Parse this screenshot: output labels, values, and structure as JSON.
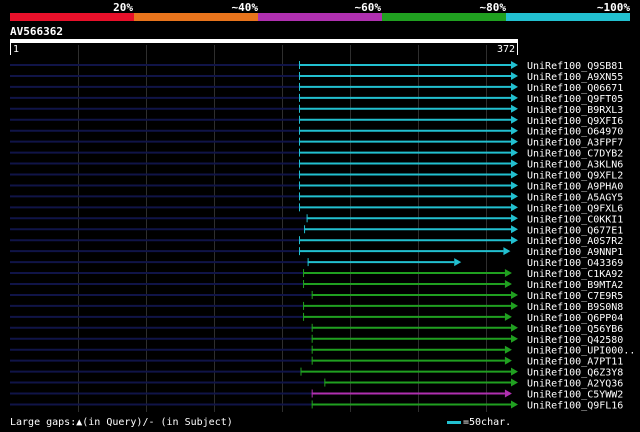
{
  "colors": {
    "red": "#e8102a",
    "orange": "#e8741c",
    "purple": "#b030b0",
    "green": "#20a020",
    "cyan": "#22c0d0",
    "navy": "#101448",
    "grid": "#2e2e2e",
    "text": "#ffffff"
  },
  "legend": {
    "labels": [
      "20%",
      "~40%",
      "~60%",
      "~80%",
      "~100%"
    ]
  },
  "query": {
    "id": "AV566362",
    "start": "1",
    "end": "372"
  },
  "hits": [
    {
      "name": "UniRef100_Q9SB81",
      "start": 0.57,
      "end": 1.0,
      "color": "cyan"
    },
    {
      "name": "UniRef100_A9XN55",
      "start": 0.57,
      "end": 1.0,
      "color": "cyan"
    },
    {
      "name": "UniRef100_Q06671",
      "start": 0.57,
      "end": 1.0,
      "color": "cyan"
    },
    {
      "name": "UniRef100_Q9FT05",
      "start": 0.57,
      "end": 1.0,
      "color": "cyan"
    },
    {
      "name": "UniRef100_B9RXL3",
      "start": 0.57,
      "end": 1.0,
      "color": "cyan"
    },
    {
      "name": "UniRef100_Q9XFI6",
      "start": 0.57,
      "end": 1.0,
      "color": "cyan"
    },
    {
      "name": "UniRef100_O64970",
      "start": 0.57,
      "end": 1.0,
      "color": "cyan"
    },
    {
      "name": "UniRef100_A3FPF7",
      "start": 0.57,
      "end": 1.0,
      "color": "cyan"
    },
    {
      "name": "UniRef100_C7DYB2",
      "start": 0.57,
      "end": 1.0,
      "color": "cyan"
    },
    {
      "name": "UniRef100_A3KLN6",
      "start": 0.57,
      "end": 1.0,
      "color": "cyan"
    },
    {
      "name": "UniRef100_Q9XFL2",
      "start": 0.57,
      "end": 1.0,
      "color": "cyan"
    },
    {
      "name": "UniRef100_A9PHA0",
      "start": 0.57,
      "end": 1.0,
      "color": "cyan"
    },
    {
      "name": "UniRef100_A5AGY5",
      "start": 0.57,
      "end": 1.0,
      "color": "cyan"
    },
    {
      "name": "UniRef100_Q9FXL6",
      "start": 0.57,
      "end": 1.0,
      "color": "cyan"
    },
    {
      "name": "UniRef100_C0KKI1",
      "start": 0.585,
      "end": 1.0,
      "color": "cyan"
    },
    {
      "name": "UniRef100_Q677E1",
      "start": 0.58,
      "end": 1.0,
      "color": "cyan"
    },
    {
      "name": "UniRef100_A0S7R2",
      "start": 0.57,
      "end": 1.0,
      "color": "cyan"
    },
    {
      "name": "UniRef100_A9NNP1",
      "start": 0.57,
      "end": 0.985,
      "color": "cyan"
    },
    {
      "name": "UniRef100_O43369",
      "start": 0.587,
      "end": 0.888,
      "color": "cyan"
    },
    {
      "name": "UniRef100_C1KA92",
      "start": 0.578,
      "end": 0.988,
      "color": "green"
    },
    {
      "name": "UniRef100_B9MTA2",
      "start": 0.578,
      "end": 0.988,
      "color": "green"
    },
    {
      "name": "UniRef100_C7E9R5",
      "start": 0.595,
      "end": 1.0,
      "color": "green"
    },
    {
      "name": "UniRef100_B9S0N8",
      "start": 0.578,
      "end": 1.0,
      "color": "green"
    },
    {
      "name": "UniRef100_Q6PP04",
      "start": 0.578,
      "end": 0.988,
      "color": "green"
    },
    {
      "name": "UniRef100_Q56YB6",
      "start": 0.595,
      "end": 1.0,
      "color": "green"
    },
    {
      "name": "UniRef100_Q42580",
      "start": 0.595,
      "end": 1.0,
      "color": "green"
    },
    {
      "name": "UniRef100_UPI000..",
      "start": 0.595,
      "end": 0.988,
      "color": "green"
    },
    {
      "name": "UniRef100_A7PT11",
      "start": 0.595,
      "end": 0.988,
      "color": "green"
    },
    {
      "name": "UniRef100_Q6Z3Y8",
      "start": 0.573,
      "end": 1.0,
      "color": "green"
    },
    {
      "name": "UniRef100_A2YQ36",
      "start": 0.62,
      "end": 1.0,
      "color": "green"
    },
    {
      "name": "UniRef100_C5YWW2",
      "start": 0.595,
      "end": 0.988,
      "color": "purple"
    },
    {
      "name": "UniRef100_Q9FL16",
      "start": 0.595,
      "end": 1.0,
      "color": "green"
    }
  ],
  "footer": {
    "gaps_text": "Large gaps:▲(in Query)/- (in Subject)",
    "scale_text": "=50char."
  }
}
